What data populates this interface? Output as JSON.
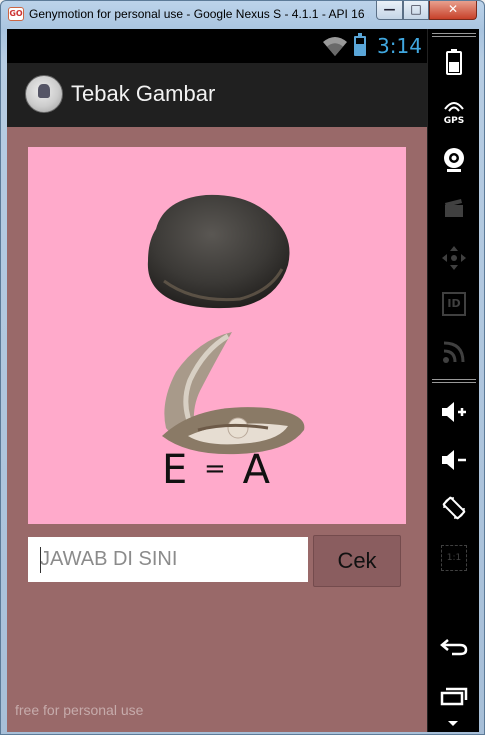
{
  "window": {
    "title": "Genymotion for personal use - Google Nexus S - 4.1.1 - API 16 ...",
    "icon_text": "GO",
    "minimize_glyph": "—",
    "maximize_glyph": "□",
    "close_glyph": "✕"
  },
  "status_bar": {
    "time": "3:14",
    "icons": [
      "wifi-icon",
      "battery-icon"
    ],
    "accent_color": "#40a8e0"
  },
  "action_bar": {
    "title": "Tebak Gambar",
    "icon": "app-logo-icon"
  },
  "puzzle": {
    "background_color": "#ffaacb",
    "images": [
      "rock-image",
      "oyster-shell-image"
    ],
    "equation_left": "E",
    "equation_op": "=",
    "equation_right": "A"
  },
  "answer": {
    "placeholder": "JAWAB DI SINI",
    "value": ""
  },
  "check_button": {
    "label": "Cek"
  },
  "watermark": "free for personal use",
  "emulator_sidebar": {
    "buttons": [
      {
        "icon": "battery-icon",
        "enabled": true
      },
      {
        "icon": "gps-icon",
        "label": "GPS",
        "enabled": true
      },
      {
        "icon": "camera-icon",
        "enabled": true
      },
      {
        "icon": "clapper-icon",
        "enabled": false
      },
      {
        "icon": "dpad-icon",
        "enabled": false
      },
      {
        "icon": "id-icon",
        "label": "ID",
        "enabled": false
      },
      {
        "icon": "cast-icon",
        "enabled": false
      },
      {
        "icon": "volume-up-icon",
        "enabled": true
      },
      {
        "icon": "volume-down-icon",
        "enabled": true
      },
      {
        "icon": "rotate-icon",
        "enabled": true
      },
      {
        "icon": "scale-icon",
        "label": "1:1",
        "enabled": false
      },
      {
        "icon": "back-icon",
        "enabled": true
      },
      {
        "icon": "recent-apps-icon",
        "enabled": true
      }
    ]
  }
}
